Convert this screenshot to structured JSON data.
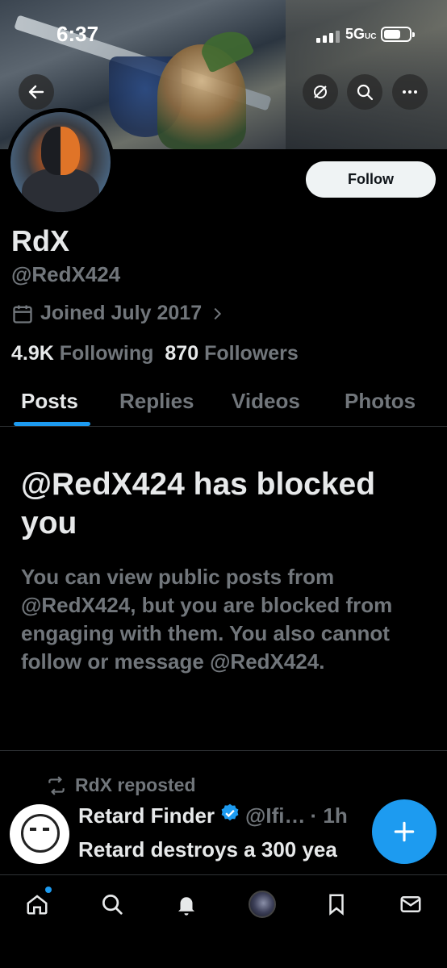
{
  "status_bar": {
    "time": "6:37",
    "network": "5G",
    "network_suffix": "UC"
  },
  "header": {
    "icons": [
      "back-arrow-icon",
      "grok-icon",
      "search-icon",
      "more-icon"
    ]
  },
  "profile": {
    "name": "RdX",
    "handle": "@RedX424",
    "joined": "Joined July 2017",
    "following_count": "4.9K",
    "following_label": "Following",
    "followers_count": "870",
    "followers_label": "Followers",
    "follow_label": "Follow"
  },
  "tabs": [
    {
      "label": "Posts",
      "active": true
    },
    {
      "label": "Replies"
    },
    {
      "label": "Videos"
    },
    {
      "label": "Photos"
    }
  ],
  "blocked": {
    "title": "@RedX424 has blocked you",
    "description": "You can view public posts from @RedX424, but you are blocked from engaging with them. You also cannot follow or message @RedX424."
  },
  "post": {
    "repost_label": "RdX reposted",
    "author_name": "Retard Finder",
    "author_handle": "@Ifi…",
    "time": "· 1h",
    "text": "Retard destroys a 300 yea"
  },
  "colors": {
    "accent": "#1d9bf0",
    "muted": "#71767b",
    "text": "#e7e9ea"
  },
  "bottom_nav": [
    "home-icon",
    "search-icon",
    "notifications-icon",
    "communities-avatar",
    "bookmarks-icon",
    "messages-icon"
  ]
}
